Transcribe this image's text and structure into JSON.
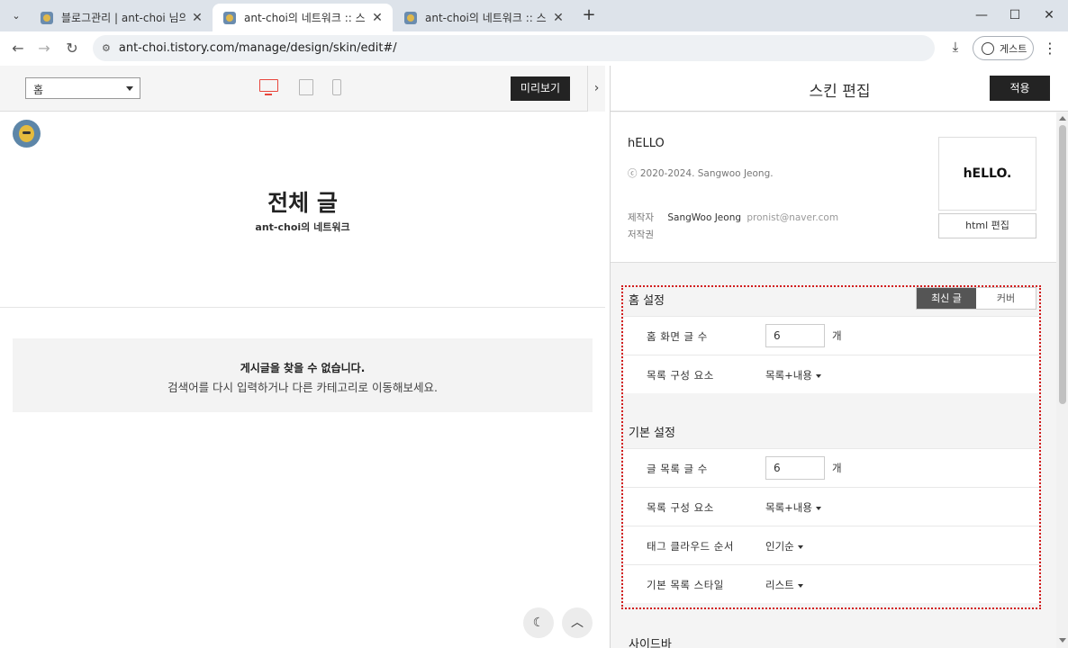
{
  "browser": {
    "tabs": [
      {
        "title": "블로그관리 | ant-choi 님의 블로그",
        "active": false
      },
      {
        "title": "ant-choi의 네트워크 :: 스킨편집",
        "active": true
      },
      {
        "title": "ant-choi의 네트워크 :: 스킨편집",
        "active": false
      }
    ],
    "url": "ant-choi.tistory.com/manage/design/skin/edit#/",
    "profile_label": "게스트"
  },
  "preview": {
    "page_select_value": "홈",
    "preview_button": "미리보기",
    "hero_title": "전체 글",
    "hero_subtitle": "ant-choi의 네트워크",
    "empty_title": "게시글을 찾을 수 없습니다.",
    "empty_desc": "검색어를 다시 입력하거나 다른 카테고리로 이동해보세요."
  },
  "editor": {
    "title": "스킨 편집",
    "apply_button": "적용",
    "skin": {
      "name": "hELLO",
      "copyright": "ⓒ 2020-2024. Sangwoo Jeong.",
      "maker_label": "제작자",
      "author": "SangWoo Jeong",
      "email": "pronist@naver.com",
      "license_label": "저작권",
      "thumbnail_text": "hELLO.",
      "html_edit_button": "html 편집"
    },
    "home_settings": {
      "title": "홈 설정",
      "mode_tabs": [
        "최신 글",
        "커버"
      ],
      "selected_mode": "최신 글",
      "rows": [
        {
          "label": "홈 화면 글 수",
          "value": "6",
          "unit": "개"
        },
        {
          "label": "목록 구성 요소",
          "value": "목록+내용"
        }
      ]
    },
    "basic_settings": {
      "title": "기본 설정",
      "rows": [
        {
          "label": "글 목록 글 수",
          "value": "6",
          "unit": "개"
        },
        {
          "label": "목록 구성 요소",
          "value": "목록+내용"
        },
        {
          "label": "태그 클라우드 순서",
          "value": "인기순"
        },
        {
          "label": "기본 목록 스타일",
          "value": "리스트"
        }
      ]
    },
    "sidebar_heading": "사이드바"
  },
  "colors": {
    "accent_red": "#e8453c",
    "dark_button": "#232323",
    "highlight_border": "#d11b1b"
  }
}
